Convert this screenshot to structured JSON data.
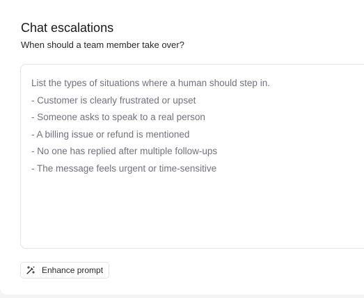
{
  "header": {
    "title": "Chat escalations",
    "subtitle": "When should a team member take over?"
  },
  "prompt": {
    "lines": [
      "List the types of situations where a human should step in.",
      "- Customer is clearly frustrated or upset",
      "- Someone asks to speak to a real person",
      "- A billing issue or refund is mentioned",
      "- No one has replied after multiple follow-ups",
      "- The message feels urgent or time-sensitive"
    ]
  },
  "actions": {
    "enhance_label": "Enhance prompt",
    "enhance_icon": "magic-wand-icon"
  }
}
